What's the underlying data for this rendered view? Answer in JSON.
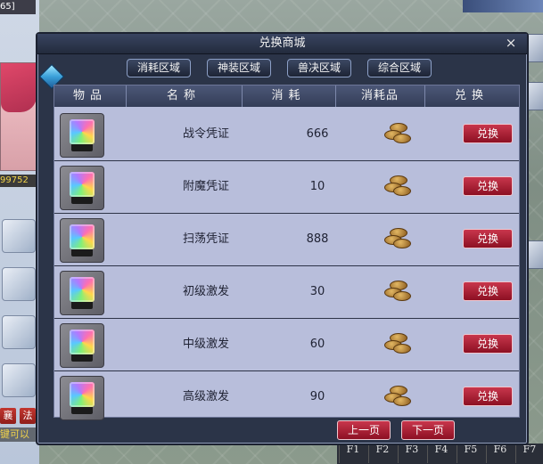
{
  "hud": {
    "top_left_text": "65]",
    "money_text": "99752",
    "hint_text": "键可以",
    "left_button_1": "襄",
    "left_button_2": "法",
    "function_keys": [
      "F1",
      "F2",
      "F3",
      "F4",
      "F5",
      "F6",
      "F7"
    ]
  },
  "dialog": {
    "title": "兑换商城",
    "close_label": "×",
    "tabs": [
      {
        "label": "消耗区域"
      },
      {
        "label": "神装区域"
      },
      {
        "label": "兽决区域"
      },
      {
        "label": "综合区域"
      }
    ],
    "headers": {
      "item": "物品",
      "name": "名称",
      "cost": "消耗",
      "currency": "消耗品",
      "exchange": "兑换"
    },
    "rows": [
      {
        "name": "战令凭证",
        "cost": "666",
        "button": "兑换"
      },
      {
        "name": "附魔凭证",
        "cost": "10",
        "button": "兑换"
      },
      {
        "name": "扫荡凭证",
        "cost": "888",
        "button": "兑换"
      },
      {
        "name": "初级激发",
        "cost": "30",
        "button": "兑换"
      },
      {
        "name": "中级激发",
        "cost": "60",
        "button": "兑换"
      },
      {
        "name": "高级激发",
        "cost": "90",
        "button": "兑换"
      }
    ],
    "prev_page": "上一页",
    "next_page": "下一页"
  }
}
